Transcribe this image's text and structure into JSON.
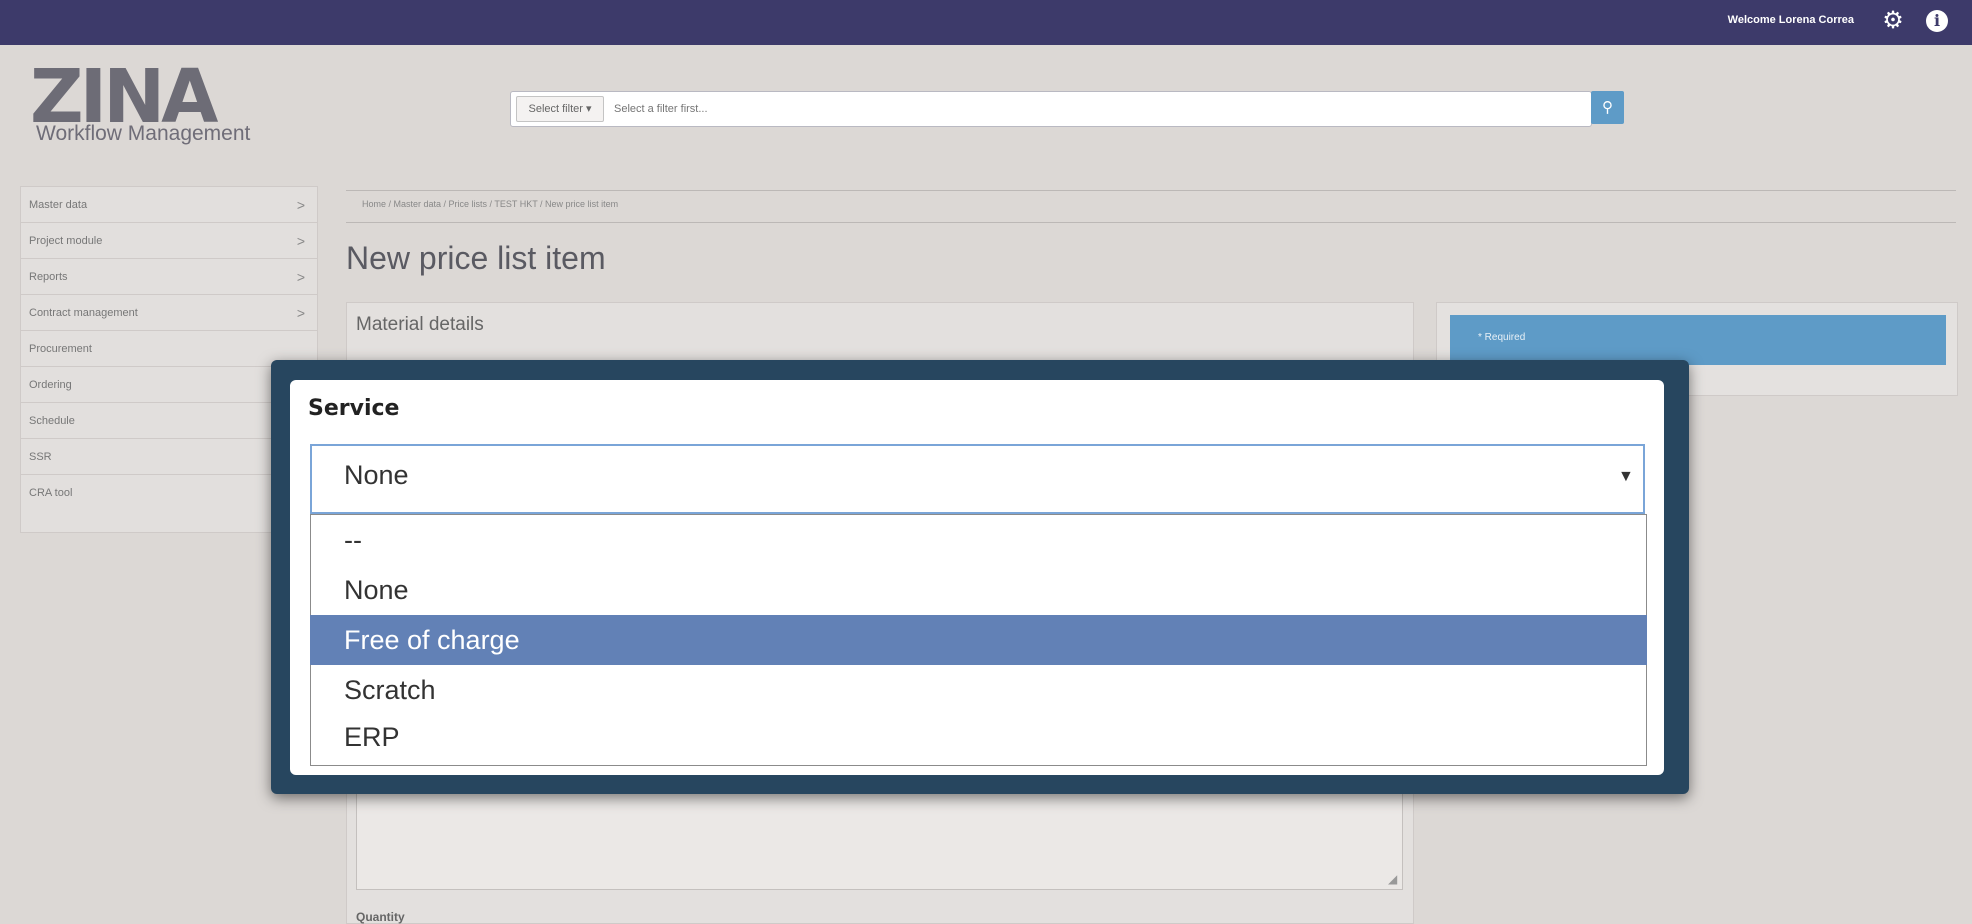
{
  "header": {
    "welcome": "Welcome Lorena Correa",
    "settings_icon": "gear-icon",
    "info_icon": "info-icon"
  },
  "logo": {
    "word": "ZINA",
    "tagline": "Workflow Management"
  },
  "search": {
    "filter_label": "Select filter ▾",
    "placeholder": "Select a filter first...",
    "button_icon": "search-icon"
  },
  "sidebar": {
    "items": [
      {
        "label": "Master data",
        "arrow": ">"
      },
      {
        "label": "Project module",
        "arrow": ">"
      },
      {
        "label": "Reports",
        "arrow": ">"
      },
      {
        "label": "Contract management",
        "arrow": ">"
      },
      {
        "label": "Procurement",
        "arrow": ""
      },
      {
        "label": "Ordering",
        "arrow": ""
      },
      {
        "label": "Schedule",
        "arrow": ""
      },
      {
        "label": "SSR",
        "arrow": ""
      },
      {
        "label": "CRA tool",
        "arrow": ""
      }
    ]
  },
  "breadcrumb": "Home / Master data / Price lists / TEST HKT / New price list item",
  "page": {
    "title": "New price list item",
    "panel_title": "Material details",
    "quantity_label": "Quantity",
    "required_text": "* Required"
  },
  "modal": {
    "label": "Service",
    "selected": "None",
    "caret": "▼",
    "options": [
      {
        "label": "--",
        "highlighted": false
      },
      {
        "label": "None",
        "highlighted": false
      },
      {
        "label": "Free of charge",
        "highlighted": true
      },
      {
        "label": "Scratch",
        "highlighted": false
      },
      {
        "label": "ERP",
        "highlighted": false
      }
    ]
  },
  "colors": {
    "topbar": "#3d3a6a",
    "accent": "#5e9bc7",
    "modal_frame": "#27465f",
    "option_highlight": "#6281b6"
  }
}
